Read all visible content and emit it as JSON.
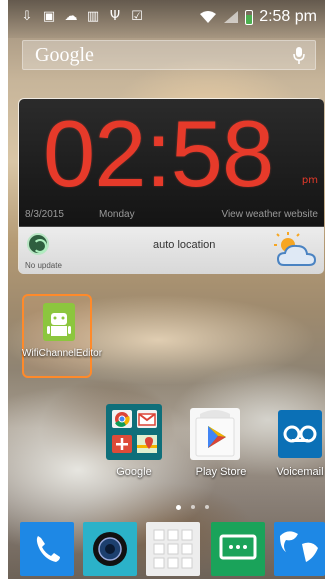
{
  "status_bar": {
    "time": "2:58 pm"
  },
  "search": {
    "label": "Google"
  },
  "clock_widget": {
    "time": "02:58",
    "ampm": "pm",
    "date": "8/3/2015",
    "day": "Monday",
    "weather_link": "View weather website",
    "location": "auto location",
    "update_status": "No update"
  },
  "apps": {
    "wifi_channel_editor": "WifiChannelEditor",
    "google_folder": "Google",
    "play_store": "Play Store",
    "voicemail": "Voicemail"
  },
  "colors": {
    "clock_red": "#e63a2a",
    "tile_highlight": "#ff8a2a"
  }
}
